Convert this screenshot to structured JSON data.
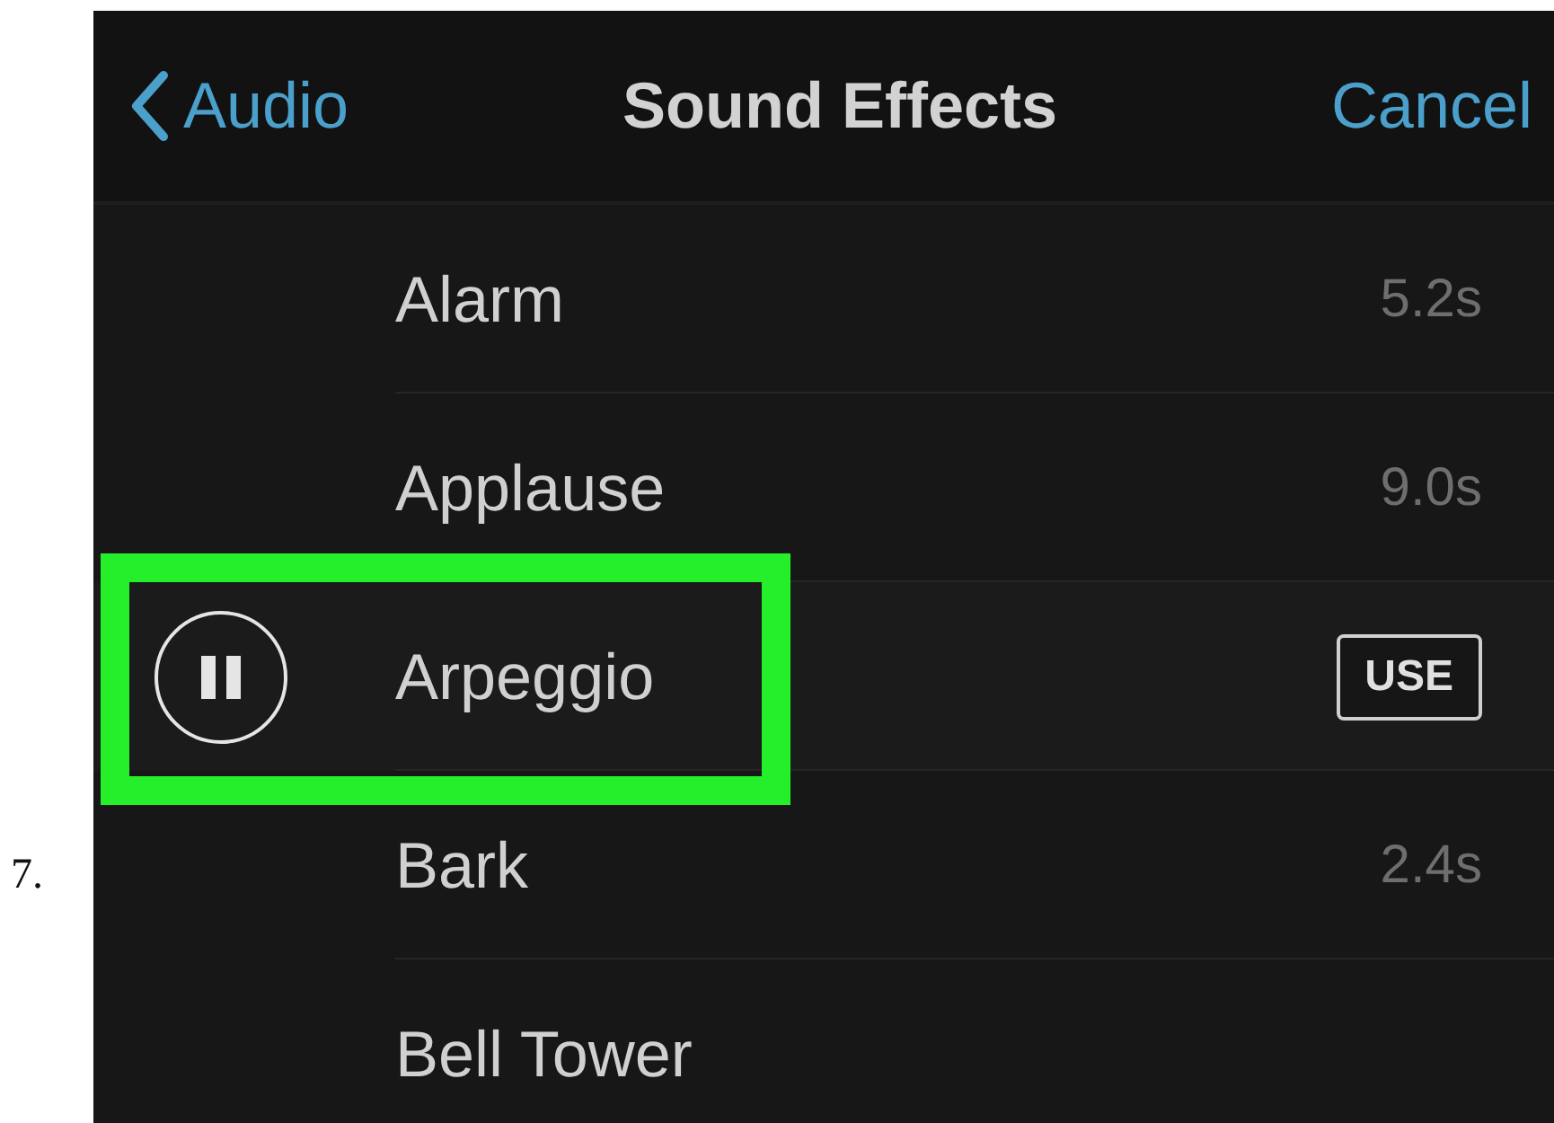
{
  "step_number": "7.",
  "nav_bar": {
    "back": "Audio",
    "title": "Sound Effects",
    "cancel": "Cancel"
  },
  "sounds": [
    {
      "name": "Alarm",
      "duration": "5.2s",
      "selected": false
    },
    {
      "name": "Applause",
      "duration": "9.0s",
      "selected": false
    },
    {
      "name": "Arpeggio",
      "use_button": "USE",
      "selected": true
    },
    {
      "name": "Bark",
      "duration": "2.4s",
      "selected": false
    },
    {
      "name": "Bell Tower",
      "selected": false
    }
  ]
}
